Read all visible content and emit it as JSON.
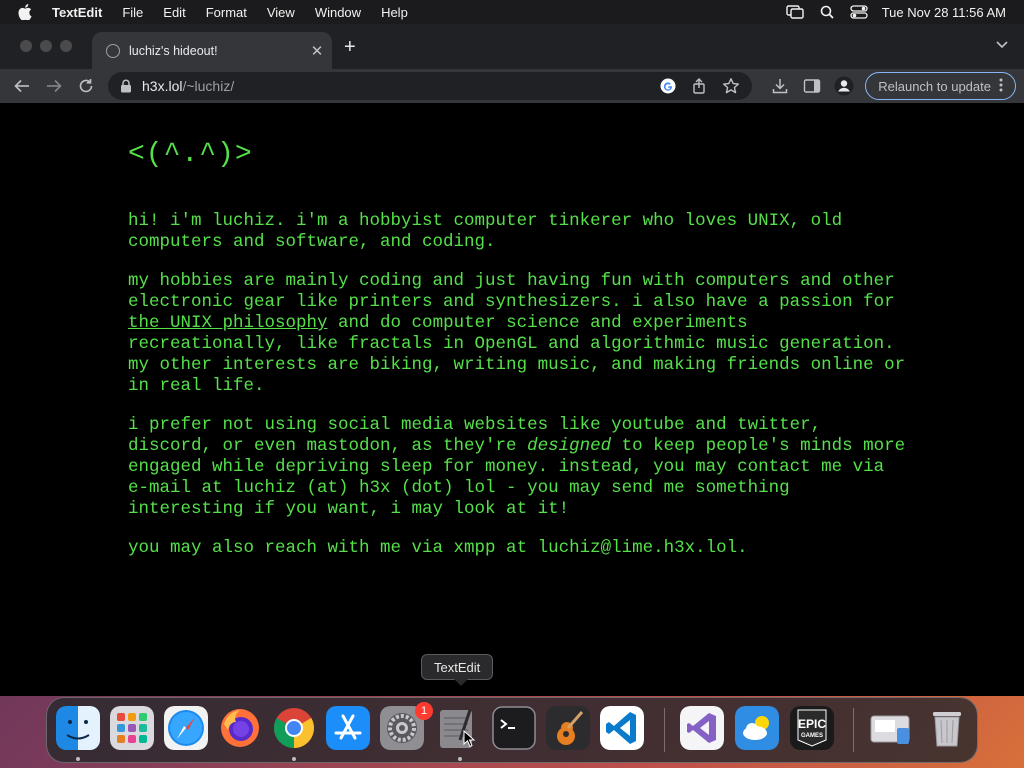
{
  "menubar": {
    "app_name": "TextEdit",
    "items": [
      "File",
      "Edit",
      "Format",
      "View",
      "Window",
      "Help"
    ],
    "clock": "Tue Nov 28  11:56 AM"
  },
  "browser": {
    "tab_title": "luchiz's hideout!",
    "url_host": "h3x.lol",
    "url_path": "/~luchiz/",
    "relaunch_label": "Relaunch to update"
  },
  "page": {
    "logo": "<(^.^)>",
    "p1": "hi! i'm luchiz. i'm a hobbyist computer tinkerer who loves UNIX, old computers and software, and coding.",
    "p2_before": "my hobbies are mainly coding and just having fun with computers and other electronic gear like printers and synthesizers. i also have a passion for ",
    "p2_link": "the UNIX philosophy",
    "p2_after": " and do computer science and experiments recreationally, like fractals in OpenGL and algorithmic music generation. my other interests are biking, writing music, and making friends online or in real life.",
    "p3_before": "i prefer not using social media websites like youtube and twitter, discord, or even mastodon, as they're ",
    "p3_em": "designed",
    "p3_after": " to keep people's minds more engaged while depriving sleep for money. instead, you may contact me via e-mail at luchiz (at) h3x (dot) lol - you may send me something interesting if you want, i may look at it!",
    "p4": "you may also reach with me via xmpp at luchiz@lime.h3x.lol.",
    "text_color": "#55e04a",
    "background": "#000000"
  },
  "dock": {
    "tooltip": "TextEdit",
    "settings_badge": "1",
    "apps": [
      "finder-icon",
      "launchpad-icon",
      "safari-icon",
      "firefox-icon",
      "chrome-icon",
      "app-store-icon",
      "system-settings-icon",
      "textedit-icon",
      "terminal-icon",
      "garageband-icon",
      "vscode-icon",
      "visual-studio-icon",
      "weather-icon",
      "epic-games-icon",
      "downloads-stack-icon",
      "trash-icon"
    ],
    "epic_label": "EPIC\nGAMES"
  }
}
